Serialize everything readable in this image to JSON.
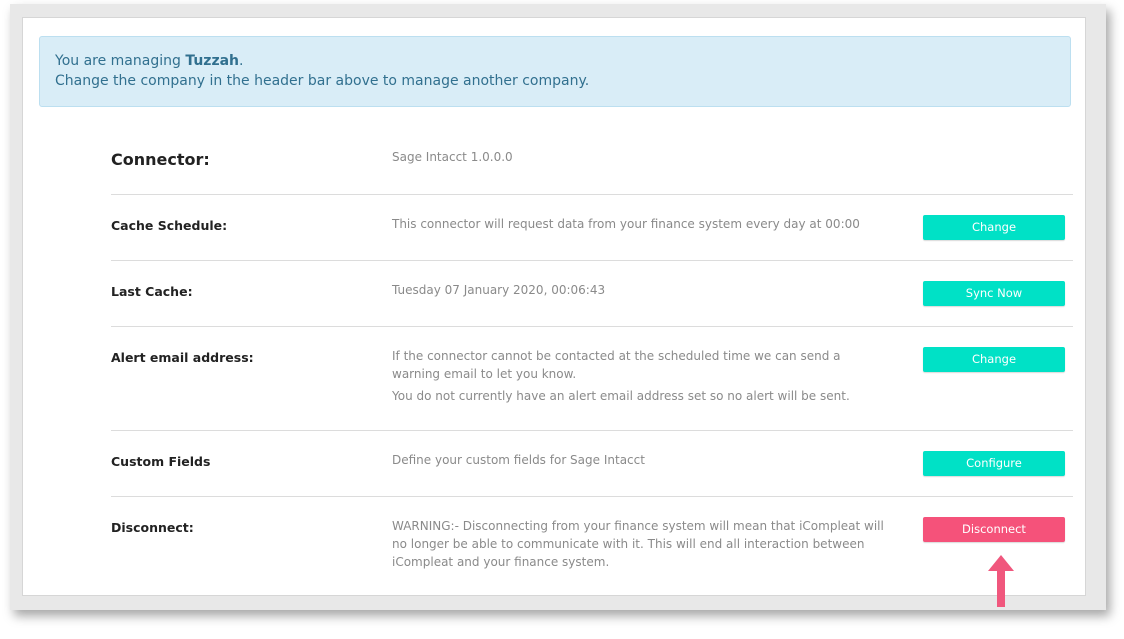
{
  "alert": {
    "prefix": "You are managing ",
    "company": "Tuzzah",
    "suffix": ".",
    "line2": "Change the company in the header bar above to manage another company."
  },
  "settings": {
    "connector": {
      "label": "Connector:",
      "value": "Sage Intacct 1.0.0.0"
    },
    "cache_schedule": {
      "label": "Cache Schedule:",
      "value": "This connector will request data from your finance system every day at 00:00",
      "button": "Change"
    },
    "last_cache": {
      "label": "Last Cache:",
      "value": "Tuesday 07 January 2020, 00:06:43",
      "button": "Sync Now"
    },
    "alert_email": {
      "label": "Alert email address:",
      "value_line1": "If the connector cannot be contacted at the scheduled time we can send a warning email to let you know.",
      "value_line2": "You do not currently have an alert email address set so no alert will be sent.",
      "button": "Change"
    },
    "custom_fields": {
      "label": "Custom Fields",
      "value": "Define your custom fields for Sage Intacct",
      "button": "Configure"
    },
    "disconnect": {
      "label": "Disconnect:",
      "value": "WARNING:- Disconnecting from your finance system will mean that iCompleat will no longer be able to communicate with it. This will end all interaction between iCompleat and your finance system.",
      "button": "Disconnect"
    }
  },
  "colors": {
    "primary_button": "#00e1c6",
    "danger_button": "#f5527a",
    "alert_background": "#d9edf7",
    "alert_text": "#31708f",
    "annotation_arrow": "#f0577d"
  },
  "icons": {
    "annotation": "arrow-up-icon"
  }
}
